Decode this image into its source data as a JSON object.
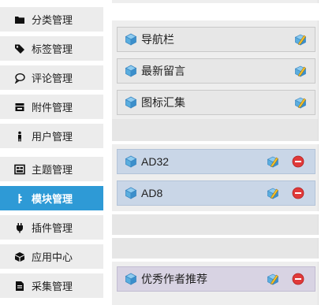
{
  "sidebar": {
    "items": [
      {
        "label": "分类管理",
        "icon": "folder-icon"
      },
      {
        "label": "标签管理",
        "icon": "tag-icon"
      },
      {
        "label": "评论管理",
        "icon": "comment-icon"
      },
      {
        "label": "附件管理",
        "icon": "attachment-icon"
      },
      {
        "label": "用户管理",
        "icon": "user-icon"
      },
      {
        "label": "主题管理",
        "icon": "theme-icon"
      },
      {
        "label": "模块管理",
        "icon": "module-icon",
        "active": true
      },
      {
        "label": "插件管理",
        "icon": "plugin-icon"
      },
      {
        "label": "应用中心",
        "icon": "app-center-icon"
      },
      {
        "label": "采集管理",
        "icon": "collect-icon"
      }
    ]
  },
  "modules": {
    "group1": [
      {
        "label": "导航栏"
      },
      {
        "label": "最新留言"
      },
      {
        "label": "图标汇集"
      }
    ],
    "group2": [
      {
        "label": "AD32"
      },
      {
        "label": "AD8"
      }
    ],
    "group3": [
      {
        "label": "优秀作者推荐"
      }
    ]
  },
  "colors": {
    "active_nav": "#2e9ad6",
    "nav_bg": "#ececec",
    "zone_bg": "#eeeeee",
    "module_grey": "#e7e7e7",
    "module_blue": "#c9d6e7",
    "module_purple": "#d8d3e3",
    "delete_red": "#e03a3a"
  }
}
